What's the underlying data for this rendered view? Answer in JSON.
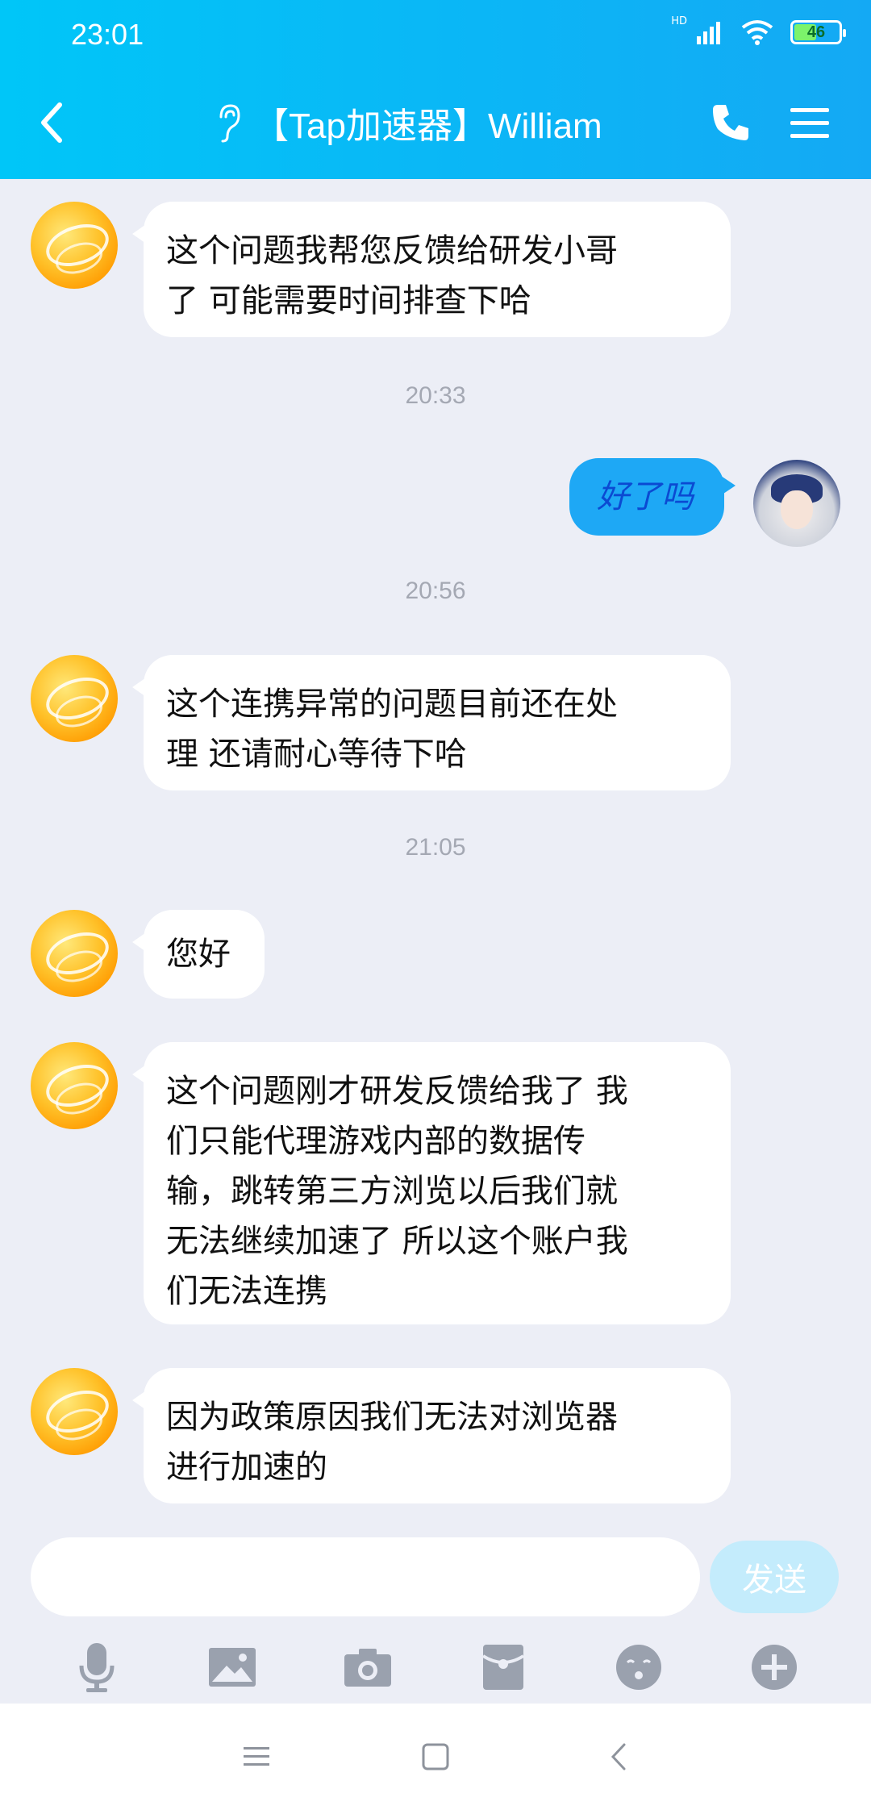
{
  "status_bar": {
    "time": "23:01",
    "network": "HD",
    "battery": "46"
  },
  "header": {
    "title": "【Tap加速器】William",
    "icons": [
      "back-arrow-icon",
      "ear-icon",
      "phone-icon",
      "menu-icon"
    ]
  },
  "messages": [
    {
      "from": "other",
      "text_lines": [
        "这个问题我帮您反馈给研发小哥",
        "了 可能需要时间排查下哈"
      ]
    },
    {
      "timestamp": "20:33"
    },
    {
      "from": "me",
      "text": "好了吗"
    },
    {
      "timestamp": "20:56"
    },
    {
      "from": "other",
      "text_lines": [
        "这个连携异常的问题目前还在处",
        "理 还请耐心等待下哈"
      ]
    },
    {
      "timestamp": "21:05"
    },
    {
      "from": "other",
      "text": "您好"
    },
    {
      "from": "other",
      "text_lines": [
        "这个问题刚才研发反馈给我了 我",
        "们只能代理游戏内部的数据传",
        "输，跳转第三方浏览以后我们就",
        "无法继续加速了 所以这个账户我",
        "们无法连携"
      ]
    },
    {
      "from": "other",
      "text_lines": [
        "因为政策原因我们无法对浏览器",
        "进行加速的"
      ]
    }
  ],
  "input": {
    "value": "",
    "placeholder": ""
  },
  "send_label": "发送",
  "toolbar_icons": [
    "microphone-icon",
    "image-icon",
    "camera-icon",
    "gift-icon",
    "emoji-icon",
    "plus-icon"
  ],
  "colors": {
    "header_start": "#00c6f8",
    "header_end": "#14a9f4",
    "my_bubble": "#1ea8f5",
    "send_disabled": "#c4ecfc"
  }
}
